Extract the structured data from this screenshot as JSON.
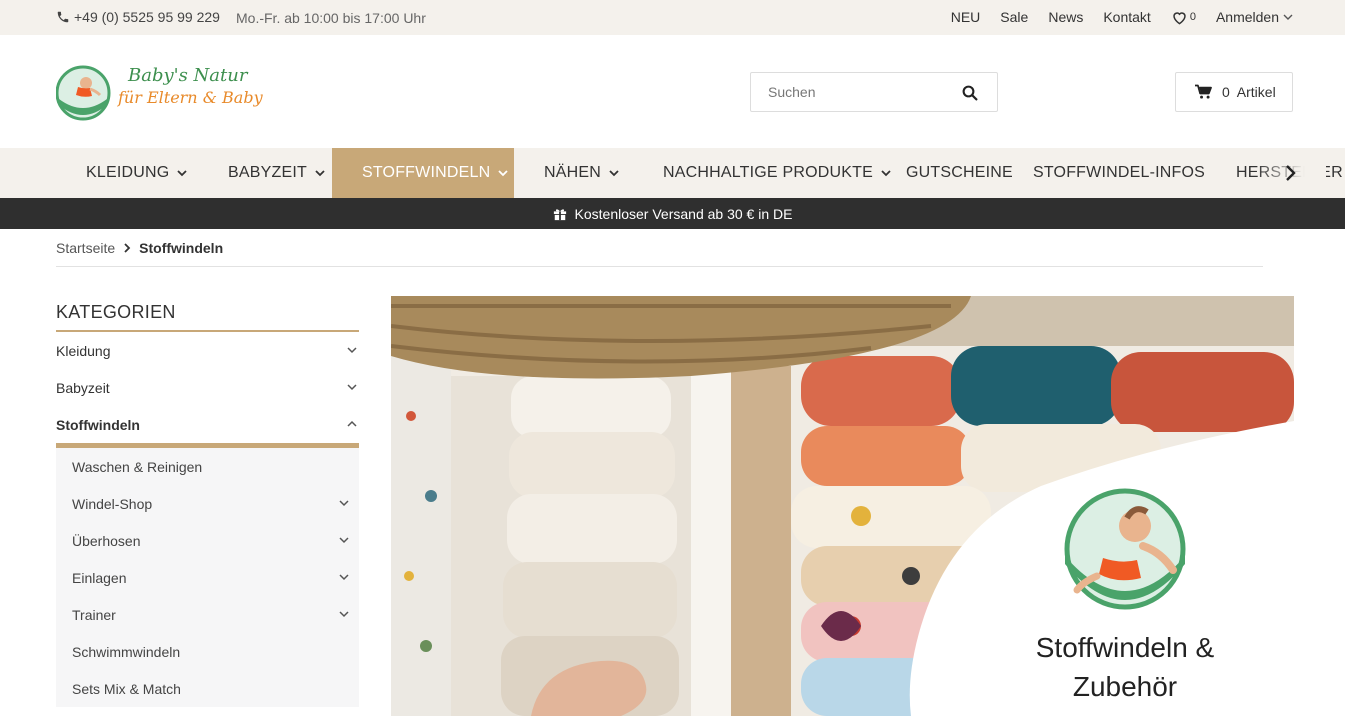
{
  "topbar": {
    "phone": "+49 (0) 5525 95 99 229",
    "hours": "Mo.-Fr. ab 10:00 bis 17:00 Uhr",
    "links": [
      "NEU",
      "Sale",
      "News",
      "Kontakt"
    ],
    "wishlist_count": "0",
    "login": "Anmelden"
  },
  "header": {
    "logo_line1": "Baby's Natur",
    "logo_line2": "für Eltern & Baby",
    "search_placeholder": "Suchen",
    "cart_label": "0  Artikel"
  },
  "nav": {
    "items": [
      {
        "label": "KLEIDUNG"
      },
      {
        "label": "BABYZEIT"
      },
      {
        "label": "STOFFWINDELN"
      },
      {
        "label": "NÄHEN"
      },
      {
        "label": "NACHHALTIGE PRODUKTE"
      },
      {
        "label": "GUTSCHEINE"
      },
      {
        "label": "STOFFWINDEL-INFOS"
      },
      {
        "label": "HERSTELLER"
      }
    ]
  },
  "promo": {
    "text": "Kostenloser Versand ab 30 € in DE"
  },
  "breadcrumb": {
    "home": "Startseite",
    "current": "Stoffwindeln"
  },
  "sidebar": {
    "title": "KATEGORIEN",
    "categories": [
      "Kleidung",
      "Babyzeit",
      "Stoffwindeln"
    ],
    "subcategories": [
      "Waschen & Reinigen",
      "Windel-Shop",
      "Überhosen",
      "Einlagen",
      "Trainer",
      "Schwimmwindeln",
      "Sets Mix & Match"
    ]
  },
  "banner": {
    "title_line1": "Stoffwindeln &",
    "title_line2": "Zubehör"
  },
  "colors": {
    "accent": "#c8a878",
    "topbar_bg": "#f4f1ec",
    "promo_bg": "#2f2f2f"
  }
}
